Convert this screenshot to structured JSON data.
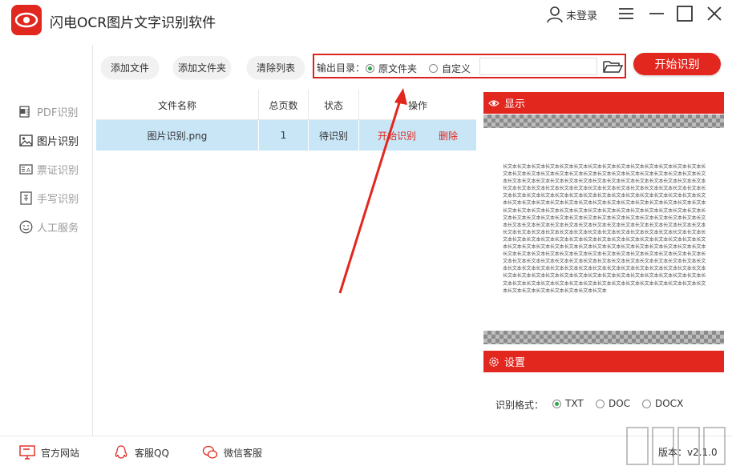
{
  "app": {
    "title": "闪电OCR图片文字识别软件",
    "user_label": "未登录"
  },
  "sidebar": {
    "items": [
      {
        "label": "PDF识别",
        "icon": "pdf-icon",
        "active": false
      },
      {
        "label": "图片识别",
        "icon": "image-icon",
        "active": true
      },
      {
        "label": "票证识别",
        "icon": "ticket-icon",
        "active": false
      },
      {
        "label": "手写识别",
        "icon": "handwriting-icon",
        "active": false
      },
      {
        "label": "人工服务",
        "icon": "smiley-icon",
        "active": false
      }
    ]
  },
  "toolbar": {
    "add_file": "添加文件",
    "add_folder": "添加文件夹",
    "clear_list": "清除列表",
    "output_label": "输出目录：",
    "option_original": "原文件夹",
    "option_custom": "自定义",
    "selected_option": "原文件夹",
    "output_path": "",
    "start_button": "开始识别"
  },
  "table": {
    "headers": [
      "文件名称",
      "总页数",
      "状态",
      "操作"
    ],
    "rows": [
      {
        "name": "图片识别.png",
        "pages": "1",
        "status": "待识别",
        "op_start": "开始识别",
        "op_delete": "删除"
      }
    ]
  },
  "preview": {
    "title": "显示",
    "sample_text": "长文本长文本长文本长文本长文本长文本长文本长文本长文本长文本长文本长文本长文本长文本长文本长文本长文本长文本长文本长文本长文本长文本长文本长文本长文本长文本长文本长文本长文本长文本长文本长文本长文本长文本长文本长文本长文本长文本长文本长文本长文本长文本长文本长文本长文本长文本长文本长文本长文本长文本长文本长文本长文本长文本长文本长文本长文本长文本长文本长文本长文本长文本长文本长文本长文本长文本长文本长文本长文本长文本长文本长文本长文本长文本长文本长文本长文本长文本长文本长文本长文本长文本长文本长文本长文本长文本长文本长文本长文本长文本长文本长文本长文本长文本长文本长文本长文本长文本长文本长文本长文本长文本长文本长文本长文本长文本长文本长文本长文本长文本长文本长文本长文本长文本长文本长文本长文本长文本长文本长文本长文本长文本长文本长文本长文本长文本长文本长文本长文本长文本长文本长文本长文本长文本长文本长文本长文本长文本长文本长文本长文本长文本长文本长文本长文本长文本长文本长文本长文本长文本长文本长文本长文本长文本长文本长文本长文本长文本长文本长文本长文本长文本长文本长文本长文本长文本长文本长文本长文本长文本长文本长文本长文本长文本长文本长文本长文本长文本长文本长文本长文本长文本长文本长文本长文本长文本长文本长文本长文本长文本长文本长文本长文本长文本长文本长文本长文本长文本长文本长文本长文本长文本长文本长文本长文本长文本长文本长文本长文本长文本长文本长文本长文本长文本长文本长文本长文本长文本长文本长文本长文本长文本长文本长文本长文本长文本长文本长文本长文本长文本长文本长文本长文本长文本长文本长文本长文本长文本长文本长文本长文本长文本长文本长文本长文本长文本长文本长文本长文本长文本长文本"
  },
  "settings": {
    "title": "设置",
    "format_label": "识别格式：",
    "formats": [
      "TXT",
      "DOC",
      "DOCX"
    ],
    "selected_format": "TXT"
  },
  "footer": {
    "website": "官方网站",
    "qq": "客服QQ",
    "wechat": "微信客服",
    "version": "版本：v2.1.0"
  },
  "colors": {
    "brand_red": "#e2271f",
    "row_selected": "#c9e6f7",
    "radio_on": "#2aa84a"
  }
}
